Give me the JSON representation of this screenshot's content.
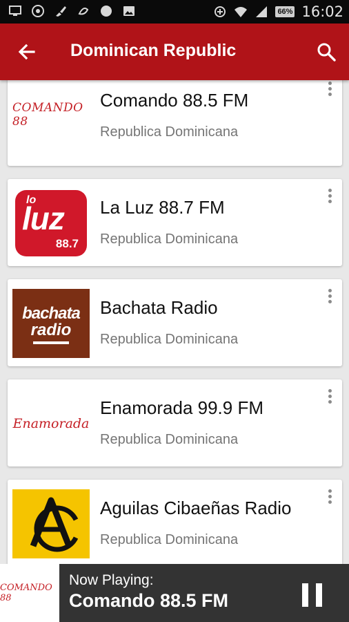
{
  "status_bar": {
    "time": "16:02",
    "battery": "66%"
  },
  "app_bar": {
    "title": "Dominican Republic"
  },
  "stations": [
    {
      "name": "Comando 88.5 FM",
      "location": "Republica Dominicana",
      "logo_text": "COMANDO 88"
    },
    {
      "name": "La Luz 88.7 FM",
      "location": "Republica Dominicana",
      "logo_text_top": "lo",
      "logo_text_mid": "luz",
      "logo_text_bottom": "88.7"
    },
    {
      "name": "Bachata Radio",
      "location": "Republica Dominicana",
      "logo_text_top": "bachata",
      "logo_text_bottom": "radio"
    },
    {
      "name": "Enamorada 99.9 FM",
      "location": "Republica Dominicana",
      "logo_text": "Enamorada"
    },
    {
      "name": "Aguilas Cibaeñas Radio",
      "location": "Republica Dominicana"
    }
  ],
  "now_playing": {
    "label": "Now Playing:",
    "title": "Comando 88.5 FM",
    "logo_text": "COMANDO 88"
  },
  "colors": {
    "app_bar": "#b01318",
    "status_bar": "#0a0a0a",
    "now_bar": "#333333"
  }
}
